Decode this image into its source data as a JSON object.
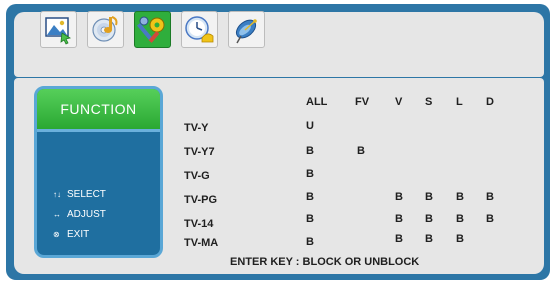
{
  "tabs": [
    {
      "name": "picture-tab",
      "icon": "picture-icon"
    },
    {
      "name": "sound-tab",
      "icon": "audio-disc-icon"
    },
    {
      "name": "function-tab",
      "icon": "settings-tools-icon",
      "active": true
    },
    {
      "name": "time-tab",
      "icon": "clock-icon"
    },
    {
      "name": "channel-tab",
      "icon": "satellite-dish-icon"
    }
  ],
  "sidebar": {
    "title": "FUNCTION",
    "hints": [
      {
        "glyph": "↑↓",
        "label": "SELECT"
      },
      {
        "glyph": "↔",
        "label": "ADJUST"
      },
      {
        "glyph": "⊗",
        "label": "EXIT"
      }
    ]
  },
  "grid": {
    "columns": [
      "ALL",
      "FV",
      "V",
      "S",
      "L",
      "D"
    ],
    "rows": [
      {
        "label": "TV-Y",
        "cells": [
          "U",
          "",
          "",
          "",
          "",
          ""
        ]
      },
      {
        "label": "TV-Y7",
        "cells": [
          "B",
          "B",
          "",
          "",
          "",
          ""
        ]
      },
      {
        "label": "TV-G",
        "cells": [
          "B",
          "",
          "",
          "",
          "",
          ""
        ]
      },
      {
        "label": "TV-PG",
        "cells": [
          "B",
          "",
          "B",
          "B",
          "B",
          "B"
        ]
      },
      {
        "label": "TV-14",
        "cells": [
          "B",
          "",
          "B",
          "B",
          "B",
          "B"
        ]
      },
      {
        "label": "TV-MA",
        "cells": [
          "B",
          "",
          "B",
          "B",
          "B",
          ""
        ]
      }
    ]
  },
  "footer": "ENTER KEY : BLOCK OR UNBLOCK",
  "colors": {
    "frame": "#2d76a6",
    "panel": "#e6e6e6",
    "sidebar": "#1f6fa0",
    "highlight": "#2fae3c"
  }
}
